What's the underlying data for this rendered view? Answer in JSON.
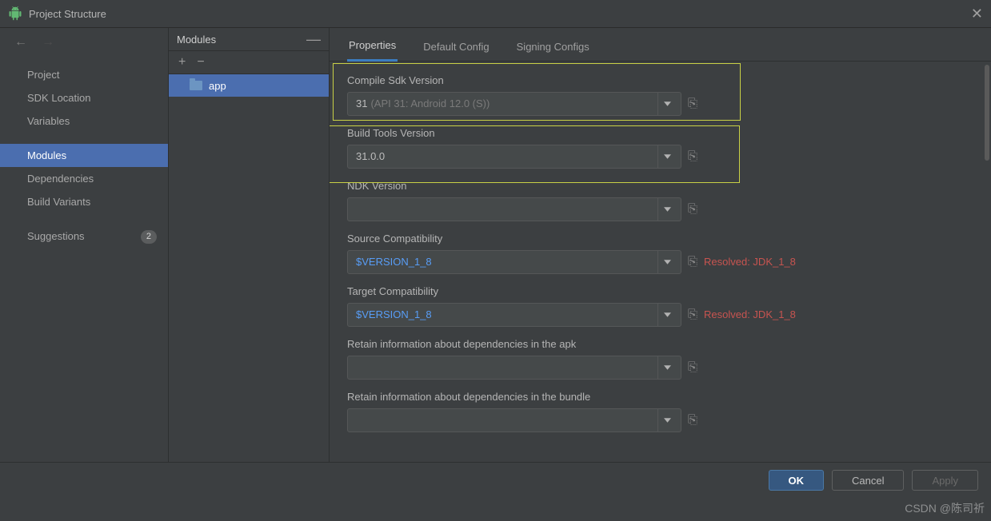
{
  "window": {
    "title": "Project Structure"
  },
  "sidebar": {
    "items": [
      {
        "label": "Project"
      },
      {
        "label": "SDK Location"
      },
      {
        "label": "Variables"
      },
      {
        "label": "Modules"
      },
      {
        "label": "Dependencies"
      },
      {
        "label": "Build Variants"
      },
      {
        "label": "Suggestions",
        "badge": "2"
      }
    ]
  },
  "midpanel": {
    "title": "Modules",
    "items": [
      {
        "name": "app"
      }
    ]
  },
  "tabs": [
    {
      "label": "Properties"
    },
    {
      "label": "Default Config"
    },
    {
      "label": "Signing Configs"
    }
  ],
  "form": {
    "compile_sdk": {
      "label": "Compile Sdk Version",
      "value": "31",
      "hint": "(API 31: Android 12.0 (S))"
    },
    "build_tools": {
      "label": "Build Tools Version",
      "value": "31.0.0"
    },
    "ndk": {
      "label": "NDK Version",
      "value": ""
    },
    "source_compat": {
      "label": "Source Compatibility",
      "value": "$VERSION_1_8",
      "resolved": "Resolved: JDK_1_8"
    },
    "target_compat": {
      "label": "Target Compatibility",
      "value": "$VERSION_1_8",
      "resolved": "Resolved: JDK_1_8"
    },
    "retain_apk": {
      "label": "Retain information about dependencies in the apk",
      "value": ""
    },
    "retain_bundle": {
      "label": "Retain information about dependencies in the bundle",
      "value": ""
    }
  },
  "footer": {
    "ok": "OK",
    "cancel": "Cancel",
    "apply": "Apply"
  },
  "watermark": "CSDN @陈司祈"
}
